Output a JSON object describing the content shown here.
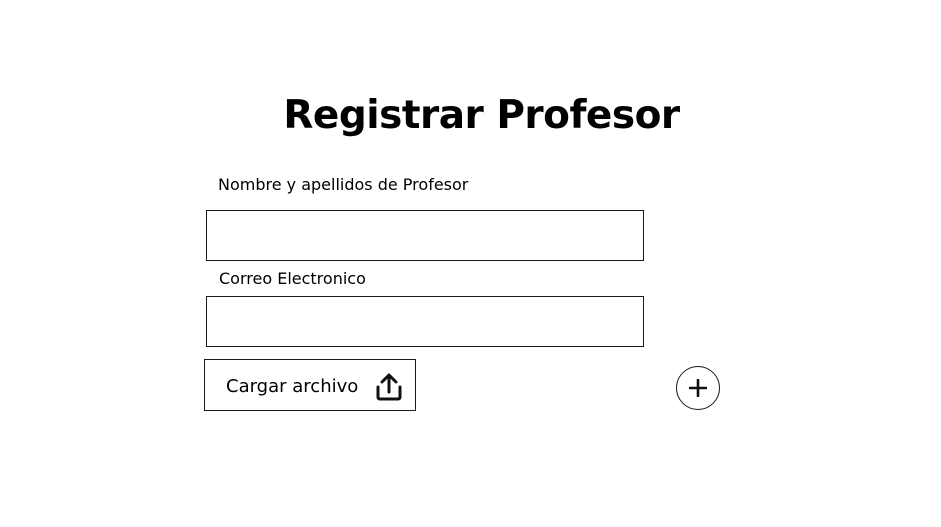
{
  "form": {
    "title": "Registrar Profesor",
    "name_field": {
      "label": "Nombre y apellidos de Profesor",
      "value": "",
      "placeholder": ""
    },
    "email_field": {
      "label": "Correo Electronico",
      "value": "",
      "placeholder": ""
    },
    "upload_button": {
      "label": "Cargar archivo",
      "icon": "upload-icon"
    },
    "add_button": {
      "icon": "plus-icon"
    }
  }
}
